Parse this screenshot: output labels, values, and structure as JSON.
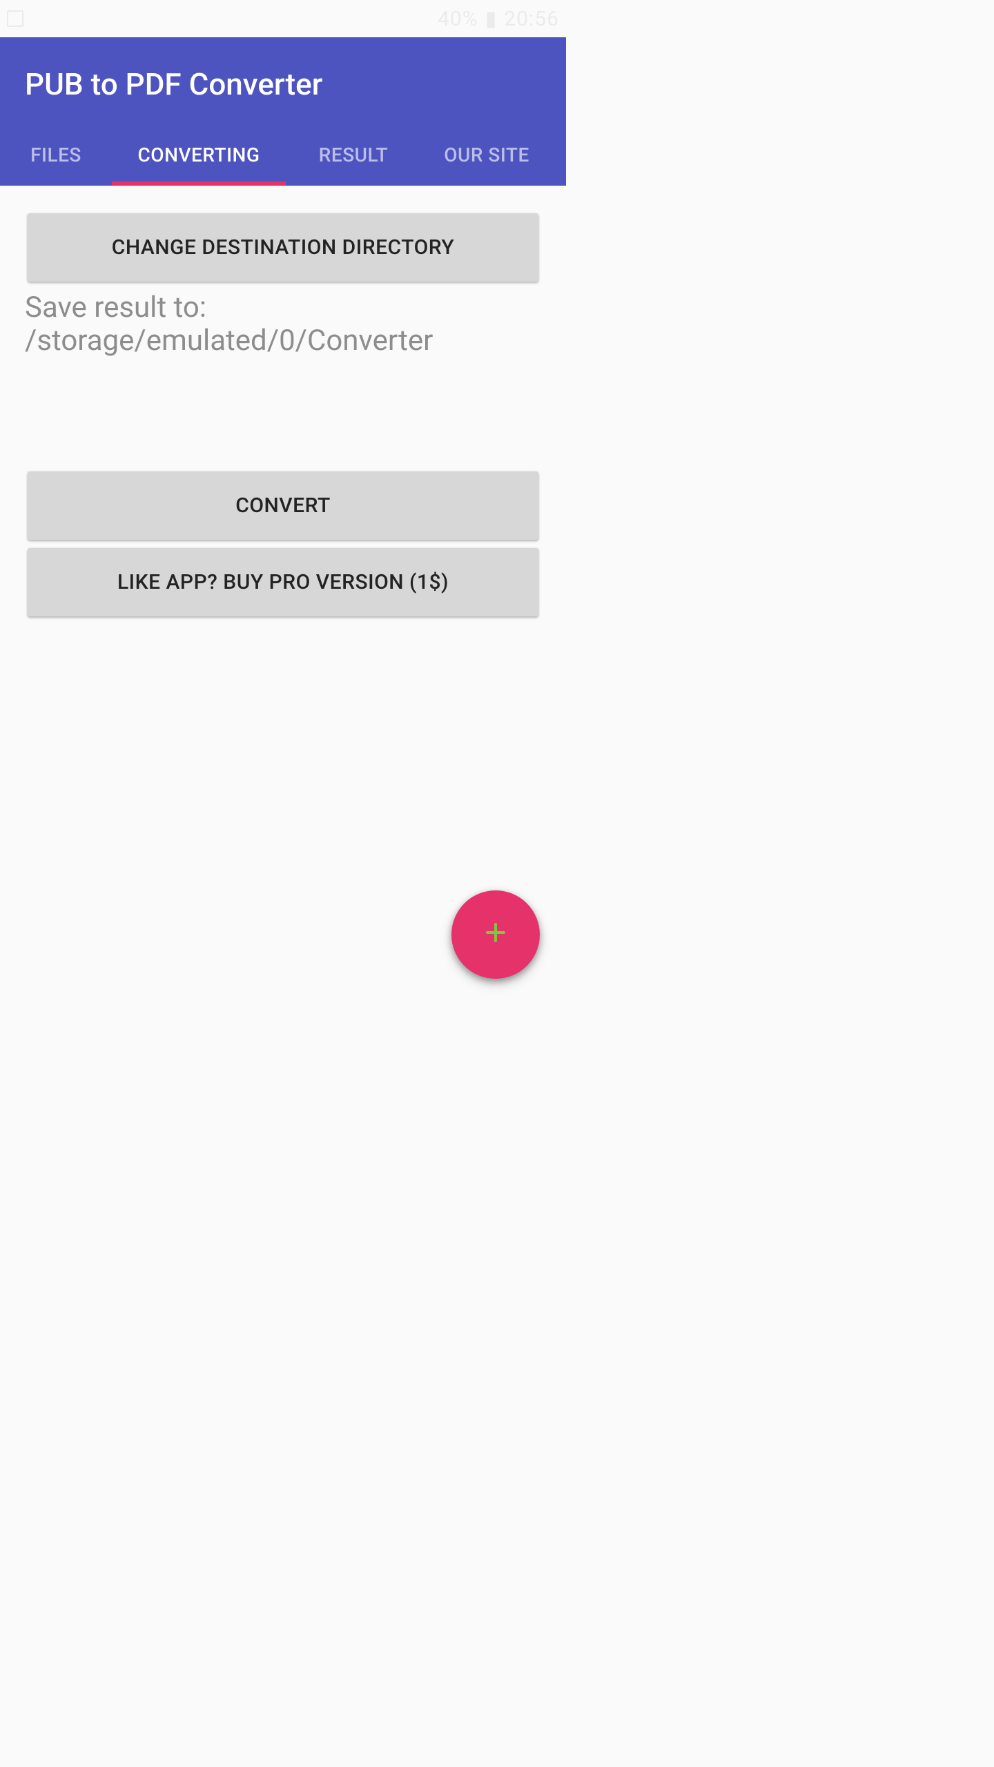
{
  "status_bar": {
    "battery_text": "40%",
    "time": "20:56"
  },
  "header": {
    "title": "PUB to PDF Converter"
  },
  "tabs": {
    "items": [
      {
        "label": "FILES"
      },
      {
        "label": "CONVERTING"
      },
      {
        "label": "RESULT"
      },
      {
        "label": "OUR SITE"
      }
    ],
    "active_index": 1
  },
  "main": {
    "change_dir_label": "CHANGE DESTINATION DIRECTORY",
    "save_path_text": "Save result to: /storage/emulated/0/Converter",
    "convert_label": "CONVERT",
    "buy_pro_label": "LIKE APP? BUY PRO VERSION (1$)"
  },
  "colors": {
    "primary": "#4d54bf",
    "accent_tab_indicator": "#e6326b",
    "fab_bg": "#e6326b",
    "fab_plus": "#7fc740",
    "button_bg": "#d7d7d7"
  }
}
